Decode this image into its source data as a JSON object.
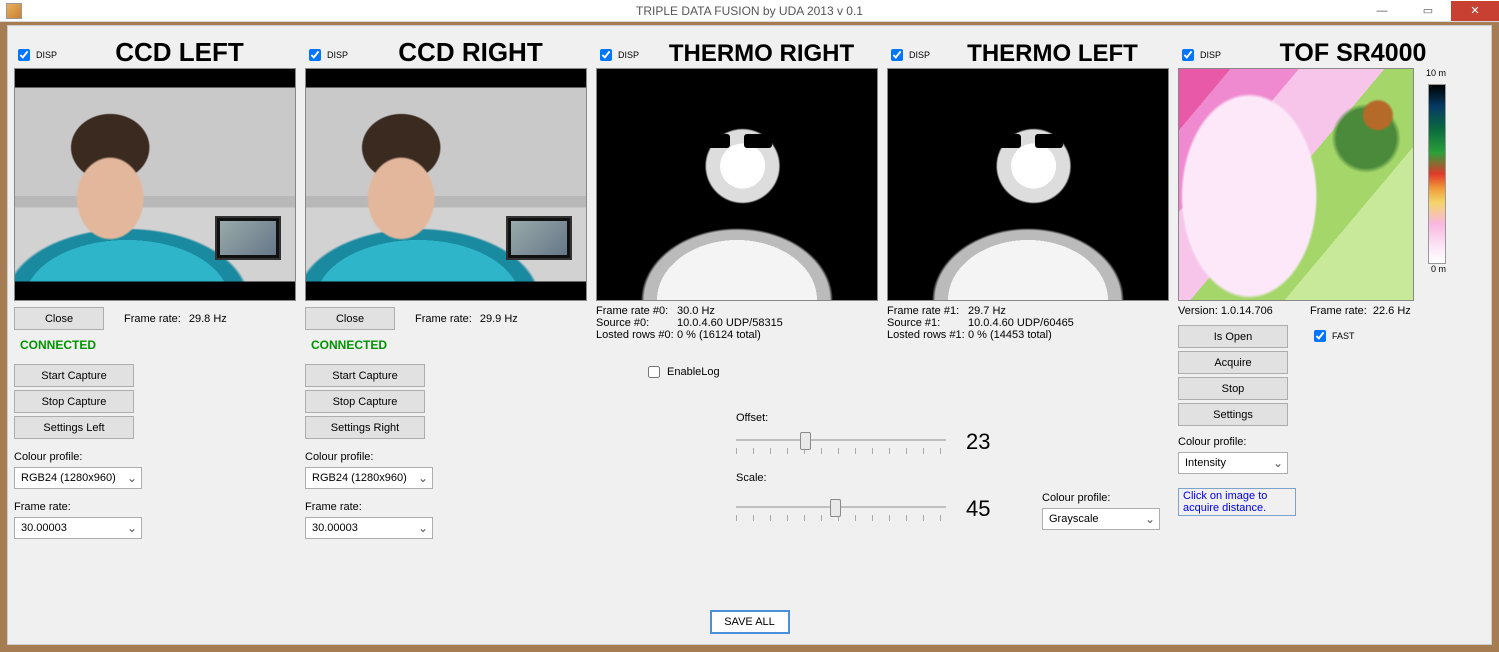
{
  "window": {
    "title": "TRIPLE DATA FUSION by UDA 2013 v 0.1"
  },
  "disp_label": "DISP",
  "common": {
    "frame_rate_label": "Frame rate:",
    "colour_profile_label": "Colour profile:",
    "connected": "CONNECTED"
  },
  "ccd_left": {
    "title": "CCD LEFT",
    "fps": "29.8 Hz",
    "close": "Close",
    "start": "Start Capture",
    "stop": "Stop Capture",
    "settings": "Settings Left",
    "colour_profile": "RGB24 (1280x960)",
    "fps_sel": "30.00003"
  },
  "ccd_right": {
    "title": "CCD RIGHT",
    "fps": "29.9 Hz",
    "close": "Close",
    "start": "Start Capture",
    "stop": "Stop Capture",
    "settings": "Settings Right",
    "colour_profile": "RGB24 (1280x960)",
    "fps_sel": "30.00003"
  },
  "thermo_right": {
    "title": "THERMO RIGHT",
    "fps_label": "Frame rate #0:",
    "fps": "30.0 Hz",
    "src_label": "Source #0:",
    "src": "10.0.4.60 UDP/58315",
    "lost_label": "Losted rows #0:",
    "lost": "0 % (16124 total)"
  },
  "thermo_left": {
    "title": "THERMO LEFT",
    "fps_label": "Frame rate #1:",
    "fps": "29.7 Hz",
    "src_label": "Source #1:",
    "src": "10.0.4.60 UDP/60465",
    "lost_label": "Losted rows #1:",
    "lost": "0 % (14453 total)"
  },
  "thermo_ctrl": {
    "offset_label": "Offset:",
    "offset_value": "23",
    "scale_label": "Scale:",
    "scale_value": "45",
    "colour_profile": "Grayscale",
    "enable_log": "EnableLog"
  },
  "tof": {
    "title": "TOF SR4000",
    "version_label": "Version:",
    "version": "1.0.14.706",
    "fps": "22.6 Hz",
    "is_open": "Is Open",
    "acquire": "Acquire",
    "stop": "Stop",
    "settings": "Settings",
    "fast": "FAST",
    "colour_profile": "Intensity",
    "hint": "Click on image to acquire distance.",
    "cb_max": "10 m",
    "cb_min": "0 m"
  },
  "save_all": "SAVE ALL"
}
